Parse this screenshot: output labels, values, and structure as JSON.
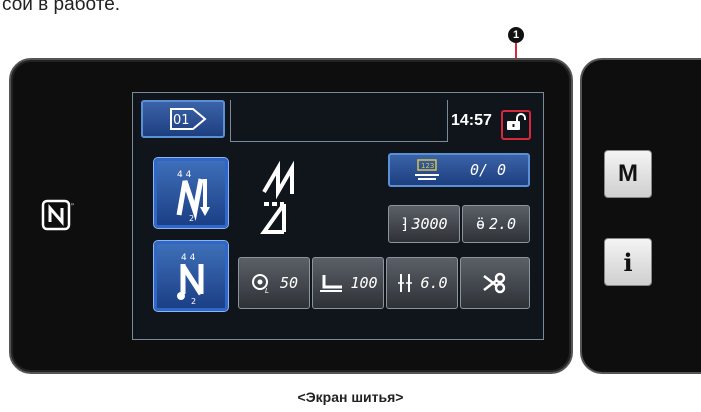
{
  "doc": {
    "top_text": "сой в работе."
  },
  "callout": {
    "number": "1"
  },
  "screen": {
    "pattern_button": {
      "label": "01"
    },
    "status": {
      "time": "14:57"
    },
    "counter": {
      "value": "0/ 0"
    },
    "speed": {
      "value": "3000"
    },
    "stitch_length": {
      "value": "2.0"
    },
    "tension": {
      "value": "50"
    },
    "presser_foot": {
      "value": "100"
    },
    "feed": {
      "value": "6.0"
    }
  },
  "side_buttons": {
    "mode_label": "M",
    "info_label": "i"
  },
  "caption": "<Экран шитья>"
}
